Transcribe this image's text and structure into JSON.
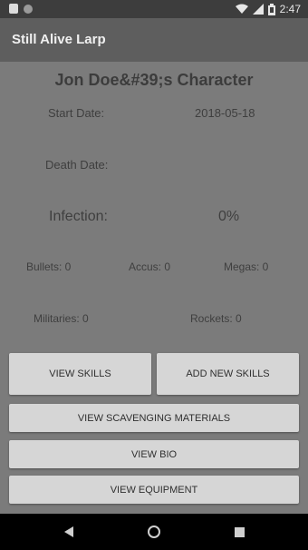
{
  "status_bar": {
    "time": "2:47"
  },
  "app": {
    "title": "Still Alive Larp"
  },
  "character": {
    "title": "Jon Doe&#39;s Character",
    "start_date_label": "Start Date:",
    "start_date_value": "2018-05-18",
    "death_date_label": "Death Date:",
    "infection_label": "Infection:",
    "infection_value": "0%",
    "bullets": "Bullets: 0",
    "accus": "Accus: 0",
    "megas": "Megas: 0",
    "militaries": "Militaries: 0",
    "rockets": "Rockets: 0"
  },
  "buttons": {
    "view_skills": "View Skills",
    "add_new_skills": "Add New Skills",
    "view_scavenging": "View Scavenging Materials",
    "view_bio": "View Bio",
    "view_equipment": "View Equipment"
  },
  "icons": {
    "status_left": [
      "sim-icon",
      "dot-icon"
    ],
    "status_right": [
      "wifi-icon",
      "signal-icon",
      "battery-icon"
    ],
    "nav": [
      "back-icon",
      "home-icon",
      "recents-icon"
    ]
  }
}
